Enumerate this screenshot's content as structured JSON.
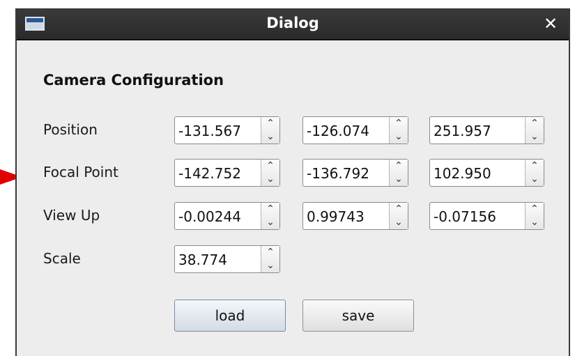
{
  "window": {
    "title": "Dialog",
    "close_glyph": "✕"
  },
  "section_title": "Camera Configuration",
  "rows": [
    {
      "label": "Position",
      "values": [
        "-131.567",
        "-126.074",
        "251.957"
      ]
    },
    {
      "label": "Focal Point",
      "values": [
        "-142.752",
        "-136.792",
        "102.950"
      ]
    },
    {
      "label": "View Up",
      "values": [
        "-0.00244",
        "0.99743",
        "-0.07156"
      ]
    },
    {
      "label": "Scale",
      "values": [
        "38.774"
      ]
    }
  ],
  "buttons": {
    "load_label": "load",
    "save_label": "save"
  },
  "spin_glyphs": {
    "up": "⌃",
    "down": "⌄"
  },
  "colors": {
    "titlebar": "#2a2a2a",
    "window_bg": "#ededed",
    "arrow": "#e00000"
  }
}
